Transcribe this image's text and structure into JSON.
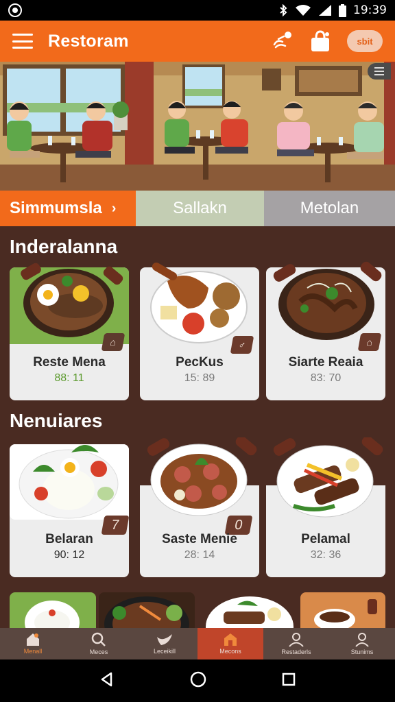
{
  "status": {
    "time": "19:39"
  },
  "appbar": {
    "title": "Restoram",
    "pill_label": "sbit"
  },
  "tabs": [
    {
      "label": "Simmumsla",
      "chevron": "›"
    },
    {
      "label": "Sallakn"
    },
    {
      "label": "Metolan"
    }
  ],
  "sections": [
    {
      "title": "Inderalanna",
      "items": [
        {
          "name": "Reste Mena",
          "price": "88: 11",
          "badge": ""
        },
        {
          "name": "PecKus",
          "price": "15: 89",
          "badge": ""
        },
        {
          "name": "Siarte Reaia",
          "price": "83: 70",
          "badge": ""
        }
      ]
    },
    {
      "title": "Nenuiares",
      "items": [
        {
          "name": "Belaran",
          "price": "90: 12",
          "badge": "7"
        },
        {
          "name": "Saste Menie",
          "price": "28: 14",
          "badge": "0"
        },
        {
          "name": "Pelamal",
          "price": "32: 36",
          "badge": ""
        }
      ]
    }
  ],
  "bottom_nav": [
    {
      "label": "Menall",
      "icon": "home-icon"
    },
    {
      "label": "Meces",
      "icon": "search-icon"
    },
    {
      "label": "Leceikill",
      "icon": "bird-icon"
    },
    {
      "label": "Mecons",
      "icon": "store-icon"
    },
    {
      "label": "Restaderls",
      "icon": "people-icon"
    },
    {
      "label": "Stunims",
      "icon": "person-icon"
    }
  ],
  "colors": {
    "brand": "#f26a1b",
    "background": "#4a2b22",
    "active_nav": "#c0452a"
  }
}
